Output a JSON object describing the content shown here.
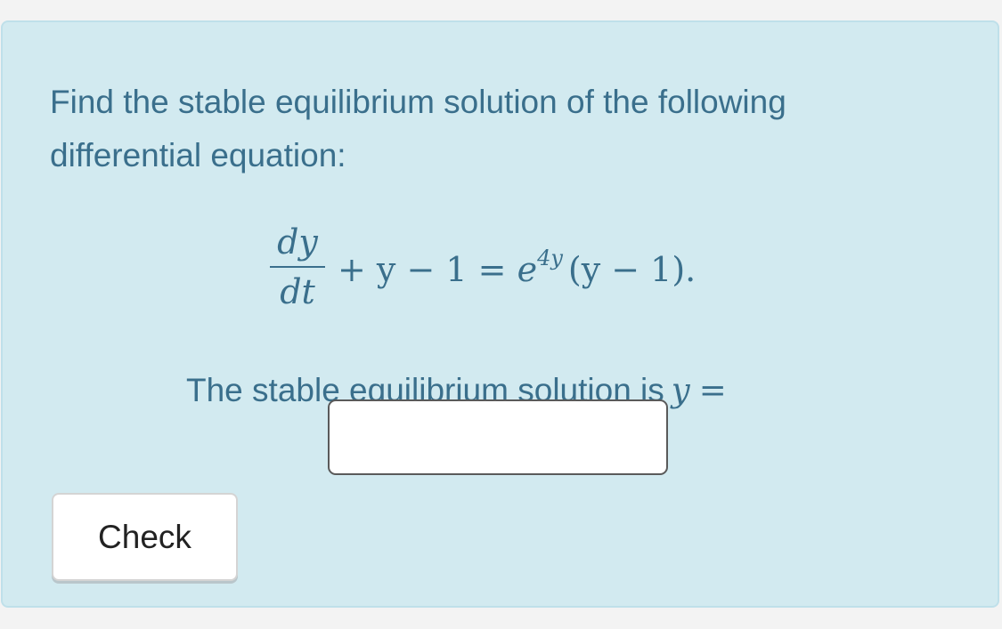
{
  "question": {
    "prompt": "Find the stable equilibrium solution of the following differential equation:"
  },
  "equation": {
    "numerator": "dy",
    "denominator": "dt",
    "lhs_rest": "+ y − 1 = ",
    "base": "e",
    "exponent": "4y",
    "rhs_rest": "(y − 1)."
  },
  "answer": {
    "label": "The stable equilibrium solution is",
    "variable": "y",
    "equals": "=",
    "input_value": ""
  },
  "actions": {
    "check_label": "Check"
  },
  "colors": {
    "card_background": "#d2eaf0",
    "text": "#3a6f8c",
    "button_text": "#222222"
  }
}
